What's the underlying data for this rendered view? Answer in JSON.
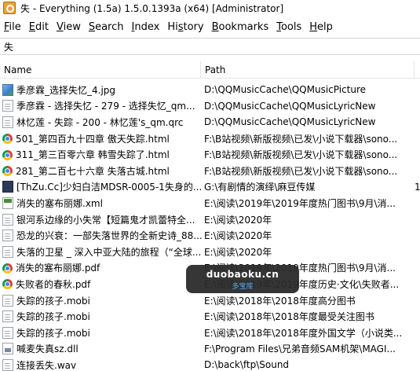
{
  "window": {
    "title": "失 - Everything (1.5a) 1.5.0.1393a (x64) [Administrator]"
  },
  "menu": [
    {
      "label": "File",
      "u": "F",
      "rest": "ile"
    },
    {
      "label": "Edit",
      "u": "E",
      "rest": "dit"
    },
    {
      "label": "View",
      "u": "V",
      "rest": "iew"
    },
    {
      "label": "Search",
      "u": "S",
      "rest": "earch"
    },
    {
      "label": "Index",
      "u": "I",
      "rest": "ndex"
    },
    {
      "label": "History",
      "pre": "Hi",
      "u": "s",
      "rest": "tory"
    },
    {
      "label": "Bookmarks",
      "u": "B",
      "rest": "ookmarks"
    },
    {
      "label": "Tools",
      "u": "T",
      "rest": "ools"
    },
    {
      "label": "Help",
      "u": "H",
      "rest": "elp"
    }
  ],
  "search": {
    "value": "失"
  },
  "columns": {
    "name": "Name",
    "path": "Path"
  },
  "rows": [
    {
      "icon": "img",
      "name": "季彦霖_选择失忆_4.jpg",
      "path": "D:\\QQMusicCache\\QQMusicPicture"
    },
    {
      "icon": "doc",
      "name": "季彦霖 - 选择失忆 - 279 - 选择失忆_qm...",
      "path": "D:\\QQMusicCache\\QQMusicLyricNew"
    },
    {
      "icon": "doc",
      "name": "林忆莲 - 失踪 - 200 - 林忆莲's_qm.qrc",
      "path": "D:\\QQMusicCache\\QQMusicLyricNew"
    },
    {
      "icon": "chrome",
      "name": "501_第四百九十四章 傲天失踪.html",
      "path": "F:\\B站视频\\新版视频\\已发\\小说下载器\\sono..."
    },
    {
      "icon": "chrome",
      "name": "311_第三百零六章 韩雪失踪了.html",
      "path": "F:\\B站视频\\新版视频\\已发\\小说下载器\\sono..."
    },
    {
      "icon": "chrome",
      "name": "281_第二百七十六章 失落古城.html",
      "path": "F:\\B站视频\\新版视频\\已发\\小说下载器\\sono..."
    },
    {
      "icon": "video",
      "name": "[ThZu.Cc]少妇白洁MDSR-0005-1失身的...",
      "path": "G:\\有剧情的演绎\\麻豆传媒",
      "extra": "1"
    },
    {
      "icon": "xml",
      "name": "消失的塞布丽娜.xml",
      "path": "E:\\阅读\\2019年\\2019年度热门图书\\9月\\消..."
    },
    {
      "icon": "doc",
      "name": "银河系边缘的小失常【短篇鬼才凯蕾特全...",
      "path": "E:\\阅读\\2020年"
    },
    {
      "icon": "doc",
      "name": "恐龙的兴衰：一部失落世界的全新史诗_88...",
      "path": "E:\\阅读\\2020年"
    },
    {
      "icon": "doc",
      "name": "失落的卫星 _ 深入中亚大陆的旅程（“全球...",
      "path": "E:\\阅读\\2020年"
    },
    {
      "icon": "pdf",
      "name": "消失的塞布丽娜.pdf",
      "path": "E:\\阅读\\2019年\\2019年度热门图书\\9月\\消..."
    },
    {
      "icon": "pdf",
      "name": "失败者的春秋.pdf",
      "path": "E:\\阅读\\2019年\\2019年度历史·文化\\失败者..."
    },
    {
      "icon": "doc",
      "name": "失踪的孩子.mobi",
      "path": "E:\\阅读\\2018年\\2018年度高分图书"
    },
    {
      "icon": "doc",
      "name": "失踪的孩子.mobi",
      "path": "E:\\阅读\\2018年\\2018年度最受关注图书"
    },
    {
      "icon": "doc",
      "name": "失踪的孩子.mobi",
      "path": "E:\\阅读\\2018年\\2018年度外国文学（小说类..."
    },
    {
      "icon": "dll",
      "name": "喊麦失真sz.dll",
      "path": "F:\\Program Files\\兄弟音频SAM机架\\MAGI..."
    },
    {
      "icon": "doc",
      "name": "连接丢失.wav",
      "path": "D:\\back\\ftp\\Sound"
    }
  ],
  "watermark": {
    "main": "duobaoku.cn",
    "sub": "多宝库"
  }
}
